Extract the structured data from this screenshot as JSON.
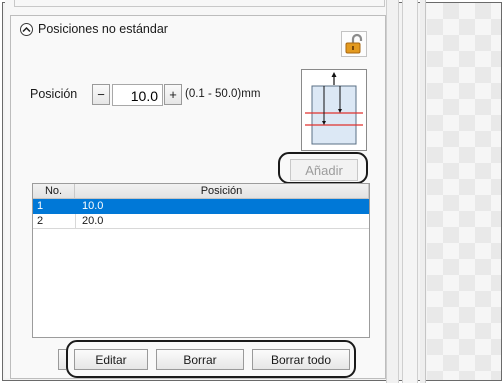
{
  "expander": {
    "label": "Posiciones no estándar"
  },
  "position": {
    "label": "Posición",
    "minus": "−",
    "value": "10.0",
    "plus": "+",
    "range": "(0.1 - 50.0)mm"
  },
  "add_label": "Añadir",
  "table": {
    "headers": [
      "No.",
      "Posición"
    ],
    "rows": [
      {
        "no": "1",
        "pos": "10.0",
        "selected": true
      },
      {
        "no": "2",
        "pos": "20.0",
        "selected": false
      }
    ]
  },
  "actions": {
    "edit": "Editar",
    "delete": "Borrar",
    "delete_all": "Borrar todo"
  },
  "colors": {
    "selection": "#0078d7",
    "guide_line": "#e0312f",
    "sheet": "#dce8f5"
  },
  "icons": {
    "expander": "chevron-up-icon",
    "lock": "unlocked-padlock-icon"
  }
}
